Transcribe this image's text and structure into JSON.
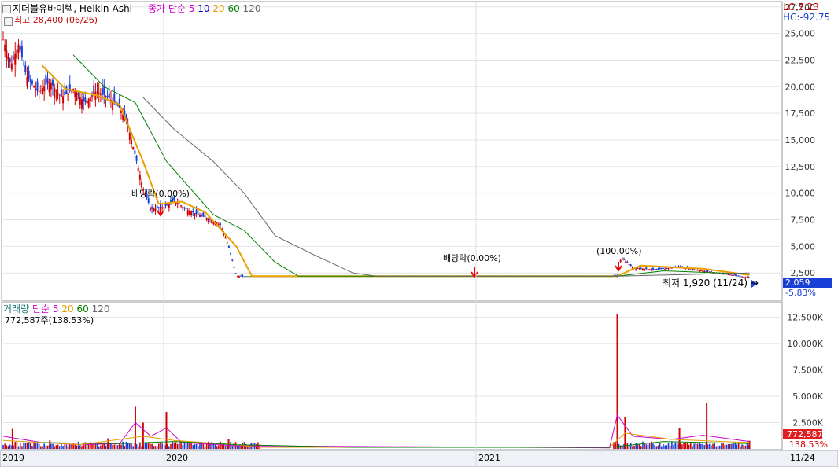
{
  "header": {
    "title": "지더블유바이텍, Heikin-Ashi",
    "ma_label": "종가 단순",
    "ma_periods": [
      "5",
      "10",
      "20",
      "60",
      "120"
    ],
    "ma_colors": [
      "#cc00cc",
      "#0000cc",
      "#e8a000",
      "#008000",
      "#666666"
    ],
    "high_label": "최고 28,400 (06/26)",
    "lc": "LC:7.23",
    "hc": "HC:-92.75"
  },
  "volume_header": {
    "title": "거래량",
    "ma_label": "단순",
    "ma_periods": [
      "5",
      "20",
      "60",
      "120"
    ],
    "value_label": "772,587주(138.53%)"
  },
  "annotations": {
    "dividend1": "배당락(0.00%)",
    "dividend2": "배당락(0.00%)",
    "split": "(100.00%)",
    "low": "최저 1,920 (11/24) →"
  },
  "price_badge": {
    "value": "2,059",
    "pct": "-5.83%"
  },
  "volume_badge": {
    "value": "772,587",
    "pct": "138.53%"
  },
  "x_labels": [
    "2019",
    "2020",
    "2021",
    "11/24"
  ],
  "chart_data": [
    {
      "type": "candlestick",
      "title": "지더블유바이텍, Heikin-Ashi",
      "y_ticks": [
        2500,
        5000,
        7500,
        10000,
        12500,
        15000,
        17500,
        20000,
        22500,
        25000,
        27500
      ],
      "y_tick_labels": [
        "2,500",
        "5,000",
        "7,500",
        "10,000",
        "12,500",
        "15,000",
        "17,500",
        "20,000",
        "22,500",
        "25,000",
        "27,500"
      ],
      "ylim": [
        2000,
        28000
      ],
      "x_range": [
        "2019",
        "11/24"
      ],
      "high": 28400,
      "low": 1920,
      "last": 2059,
      "close_path": [
        [
          0,
          24500
        ],
        [
          0.01,
          22000
        ],
        [
          0.02,
          24000
        ],
        [
          0.03,
          21000
        ],
        [
          0.045,
          19500
        ],
        [
          0.06,
          20500
        ],
        [
          0.075,
          19000
        ],
        [
          0.09,
          19800
        ],
        [
          0.105,
          18500
        ],
        [
          0.12,
          19600
        ],
        [
          0.135,
          19000
        ],
        [
          0.15,
          18000
        ],
        [
          0.16,
          16500
        ],
        [
          0.17,
          13500
        ],
        [
          0.18,
          10500
        ],
        [
          0.19,
          8500
        ],
        [
          0.2,
          8600
        ],
        [
          0.21,
          8800
        ],
        [
          0.22,
          9300
        ],
        [
          0.235,
          8500
        ],
        [
          0.25,
          8000
        ],
        [
          0.265,
          7600
        ],
        [
          0.28,
          7000
        ],
        [
          0.29,
          5000
        ],
        [
          0.3,
          2200
        ],
        [
          0.79,
          2200
        ],
        [
          0.795,
          4000
        ],
        [
          0.81,
          3000
        ],
        [
          0.84,
          2800
        ],
        [
          0.87,
          3100
        ],
        [
          0.9,
          2700
        ],
        [
          0.93,
          2400
        ],
        [
          0.96,
          2059
        ]
      ],
      "series": [
        {
          "name": "20",
          "color": "#e8a000",
          "values": [
            [
              0.05,
              22000
            ],
            [
              0.08,
              19800
            ],
            [
              0.12,
              19200
            ],
            [
              0.15,
              18300
            ],
            [
              0.18,
              13000
            ],
            [
              0.2,
              9000
            ],
            [
              0.23,
              9200
            ],
            [
              0.26,
              8200
            ],
            [
              0.3,
              5000
            ],
            [
              0.32,
              2200
            ],
            [
              0.79,
              2200
            ],
            [
              0.82,
              3200
            ],
            [
              0.9,
              2900
            ],
            [
              0.96,
              2300
            ]
          ]
        },
        {
          "name": "60",
          "color": "#008000",
          "values": [
            [
              0.09,
              23000
            ],
            [
              0.13,
              20000
            ],
            [
              0.17,
              18500
            ],
            [
              0.21,
              13000
            ],
            [
              0.27,
              8000
            ],
            [
              0.31,
              6500
            ],
            [
              0.35,
              3500
            ],
            [
              0.38,
              2200
            ],
            [
              0.79,
              2200
            ],
            [
              0.85,
              2700
            ],
            [
              0.96,
              2400
            ]
          ]
        },
        {
          "name": "120",
          "color": "#666666",
          "values": [
            [
              0.18,
              19000
            ],
            [
              0.22,
              16000
            ],
            [
              0.27,
              13000
            ],
            [
              0.31,
              10000
            ],
            [
              0.35,
              6000
            ],
            [
              0.4,
              4200
            ],
            [
              0.45,
              2500
            ],
            [
              0.48,
              2200
            ],
            [
              0.79,
              2200
            ],
            [
              0.96,
              2500
            ]
          ]
        }
      ]
    },
    {
      "type": "bar",
      "title": "거래량",
      "y_ticks": [
        2500,
        5000,
        7500,
        10000,
        12500
      ],
      "y_tick_labels": [
        "2,500K",
        "5,000K",
        "7,500K",
        "10,000K",
        "12,500K"
      ],
      "ylim": [
        0,
        13500
      ],
      "spikes": [
        [
          0.012,
          1900
        ],
        [
          0.06,
          800
        ],
        [
          0.135,
          1000
        ],
        [
          0.17,
          4000
        ],
        [
          0.18,
          2500
        ],
        [
          0.21,
          3500
        ],
        [
          0.29,
          900
        ],
        [
          0.79,
          12800
        ],
        [
          0.8,
          3000
        ],
        [
          0.87,
          2000
        ],
        [
          0.905,
          4400
        ],
        [
          0.96,
          772
        ]
      ],
      "series": [
        {
          "name": "5",
          "color": "#cc00cc",
          "values": [
            [
              0.0,
              1200
            ],
            [
              0.05,
              600
            ],
            [
              0.1,
              400
            ],
            [
              0.15,
              500
            ],
            [
              0.17,
              2500
            ],
            [
              0.19,
              1200
            ],
            [
              0.21,
              2000
            ],
            [
              0.23,
              600
            ],
            [
              0.3,
              300
            ],
            [
              0.78,
              100
            ],
            [
              0.79,
              3200
            ],
            [
              0.81,
              1200
            ],
            [
              0.86,
              900
            ],
            [
              0.9,
              1300
            ],
            [
              0.96,
              700
            ]
          ]
        },
        {
          "name": "20",
          "color": "#e8a000",
          "values": [
            [
              0.0,
              800
            ],
            [
              0.1,
              400
            ],
            [
              0.18,
              1200
            ],
            [
              0.22,
              800
            ],
            [
              0.3,
              400
            ],
            [
              0.33,
              150
            ],
            [
              0.78,
              150
            ],
            [
              0.8,
              1500
            ],
            [
              0.86,
              900
            ],
            [
              0.96,
              600
            ]
          ]
        },
        {
          "name": "60",
          "color": "#008000",
          "values": [
            [
              0.05,
              600
            ],
            [
              0.15,
              500
            ],
            [
              0.22,
              700
            ],
            [
              0.3,
              400
            ],
            [
              0.45,
              150
            ],
            [
              0.78,
              150
            ],
            [
              0.85,
              700
            ],
            [
              0.96,
              500
            ]
          ]
        }
      ]
    }
  ]
}
